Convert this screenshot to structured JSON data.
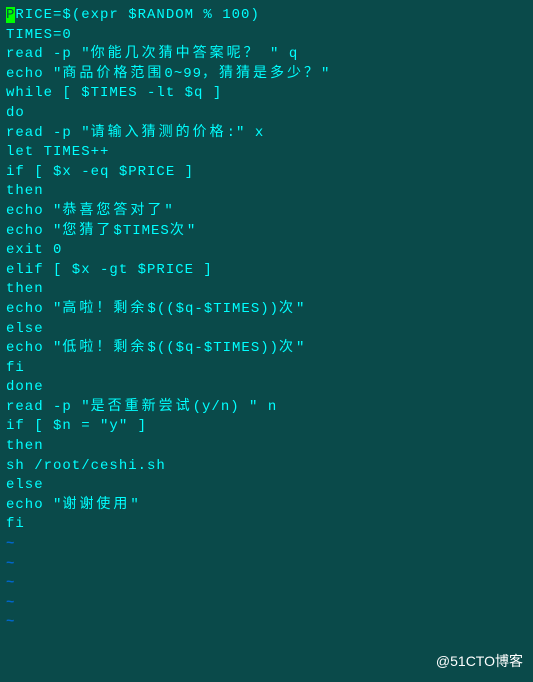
{
  "lines": {
    "l1_part1": "P",
    "l1_part2": "RICE=$(expr $RANDOM % 100)",
    "l2": "",
    "l3": "TIMES=0",
    "l4_a": "read -p \"",
    "l4_b": "你能几次猜中答案呢？",
    "l4_c": " \" q",
    "l5_a": "echo \"",
    "l5_b": "商品价格范围",
    "l5_c": "0~99",
    "l5_d": "，猜猜是多少？",
    "l5_e": "\"",
    "l6": "while [ $TIMES -lt $q ]",
    "l7": "do",
    "l8_a": "read -p \"",
    "l8_b": "请输入猜测的价格",
    "l8_c": ":\" x",
    "l9": "let TIMES++",
    "l10": "if [ $x -eq $PRICE ]",
    "l11": "then",
    "l12_a": "echo \"",
    "l12_b": "恭喜您答对了",
    "l12_c": "\"",
    "l13_a": "echo \"",
    "l13_b": "您猜了",
    "l13_c": "$TIMES",
    "l13_d": "次",
    "l13_e": "\"",
    "l14": "exit 0",
    "l15": "elif [ $x -gt $PRICE ]",
    "l16": "then",
    "l17_a": "echo \"",
    "l17_b": "高啦！剩余",
    "l17_c": "$(($q-$TIMES))",
    "l17_d": "次",
    "l17_e": "\"",
    "l18": "else",
    "l19_a": "echo \"",
    "l19_b": "低啦！剩余",
    "l19_c": "$(($q-$TIMES))",
    "l19_d": "次",
    "l19_e": "\"",
    "l20": "fi",
    "l21": "done",
    "l22_a": "read -p \"",
    "l22_b": "是否重新尝试",
    "l22_c": "(y/n) \" n",
    "l23": "if [ $n = \"y\" ]",
    "l24": "then",
    "l25": "sh /root/ceshi.sh",
    "l26": "else",
    "l27_a": "echo \"",
    "l27_b": "谢谢使用",
    "l27_c": "\"",
    "l28": "fi",
    "tilde": "~"
  },
  "watermark": "@51CTO博客"
}
